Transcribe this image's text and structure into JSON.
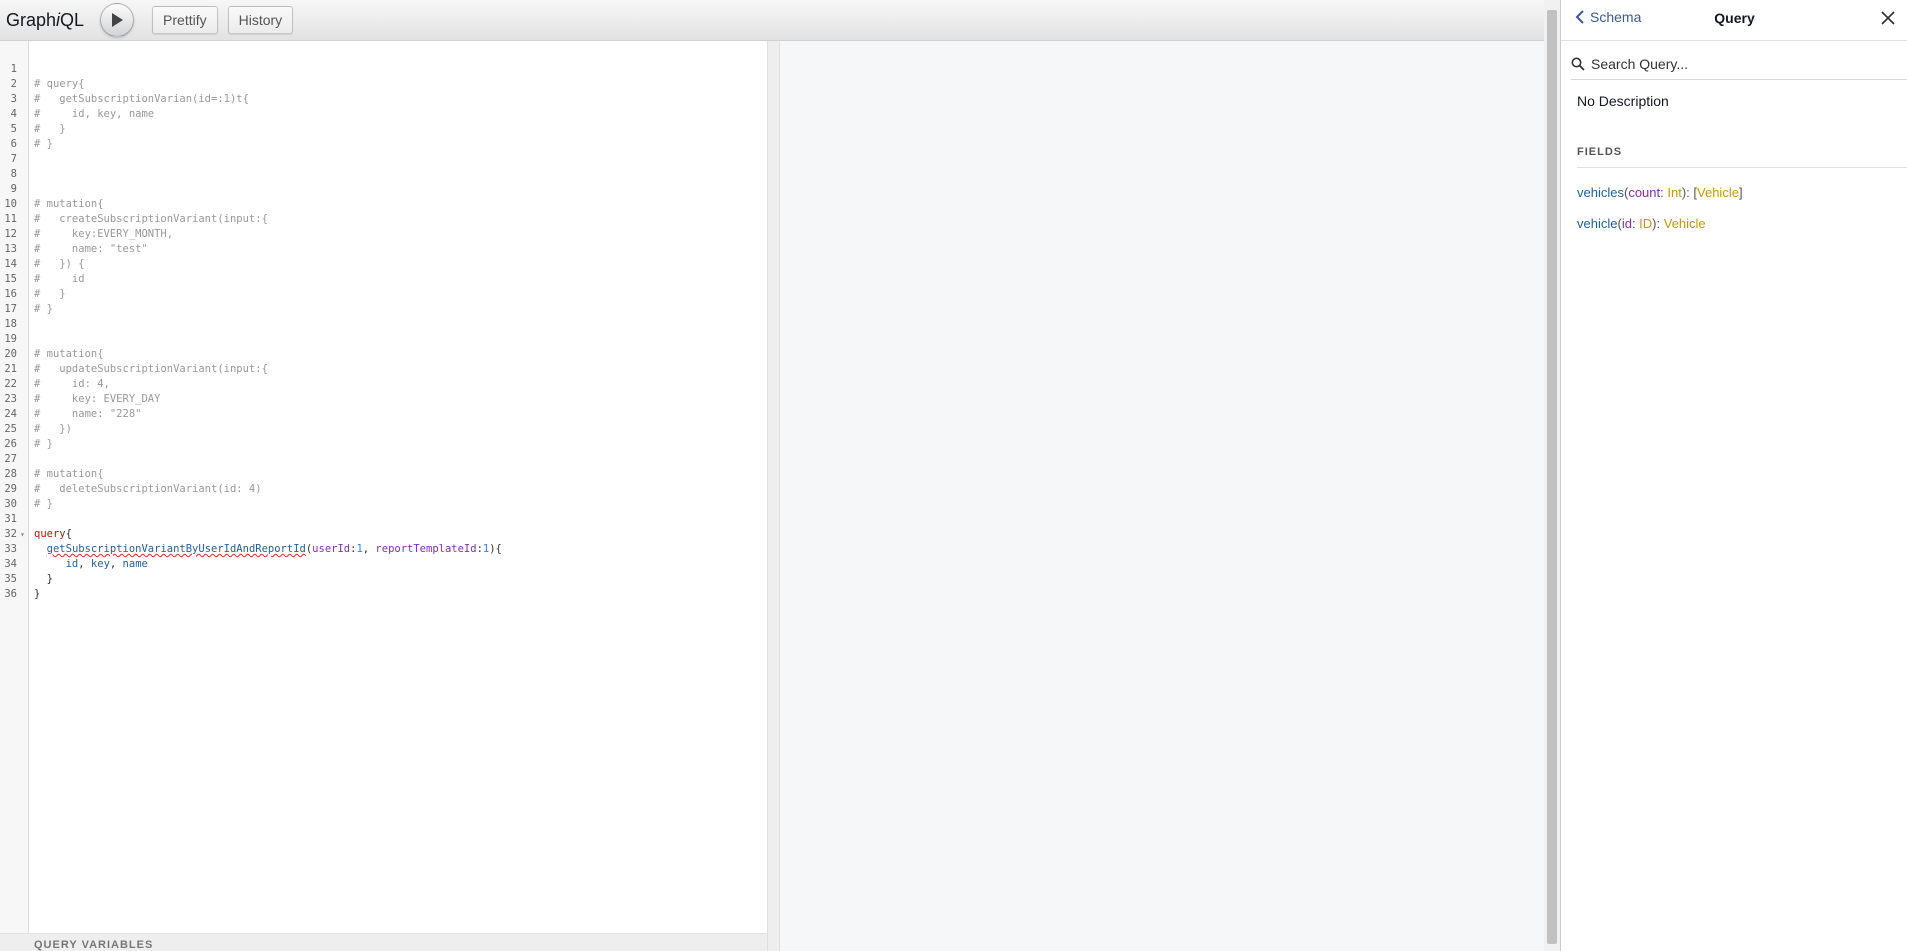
{
  "app": {
    "title_pre": "Graph",
    "title_i": "i",
    "title_post": "QL"
  },
  "toolbar": {
    "prettify_label": "Prettify",
    "history_label": "History"
  },
  "editor": {
    "lines": [
      {
        "n": "1",
        "parts": []
      },
      {
        "n": "2",
        "parts": [
          {
            "t": "# query{",
            "c": "c"
          }
        ]
      },
      {
        "n": "3",
        "parts": [
          {
            "t": "#   getSubscriptionVarian(id=:1)t{",
            "c": "c"
          }
        ]
      },
      {
        "n": "4",
        "parts": [
          {
            "t": "#     id, key, name",
            "c": "c"
          }
        ]
      },
      {
        "n": "5",
        "parts": [
          {
            "t": "#   }",
            "c": "c"
          }
        ]
      },
      {
        "n": "6",
        "parts": [
          {
            "t": "# }",
            "c": "c"
          }
        ]
      },
      {
        "n": "7",
        "parts": []
      },
      {
        "n": "8",
        "parts": []
      },
      {
        "n": "9",
        "parts": []
      },
      {
        "n": "10",
        "parts": [
          {
            "t": "# mutation{",
            "c": "c"
          }
        ]
      },
      {
        "n": "11",
        "parts": [
          {
            "t": "#   createSubscriptionVariant(input:{",
            "c": "c"
          }
        ]
      },
      {
        "n": "12",
        "parts": [
          {
            "t": "#     key:EVERY_MONTH,",
            "c": "c"
          }
        ]
      },
      {
        "n": "13",
        "parts": [
          {
            "t": "#     name: \"test\"",
            "c": "c"
          }
        ]
      },
      {
        "n": "14",
        "parts": [
          {
            "t": "#   }) {",
            "c": "c"
          }
        ]
      },
      {
        "n": "15",
        "parts": [
          {
            "t": "#     id",
            "c": "c"
          }
        ]
      },
      {
        "n": "16",
        "parts": [
          {
            "t": "#   }",
            "c": "c"
          }
        ]
      },
      {
        "n": "17",
        "parts": [
          {
            "t": "# }",
            "c": "c"
          }
        ]
      },
      {
        "n": "18",
        "parts": []
      },
      {
        "n": "19",
        "parts": []
      },
      {
        "n": "20",
        "parts": [
          {
            "t": "# mutation{",
            "c": "c"
          }
        ]
      },
      {
        "n": "21",
        "parts": [
          {
            "t": "#   updateSubscriptionVariant(input:{",
            "c": "c"
          }
        ]
      },
      {
        "n": "22",
        "parts": [
          {
            "t": "#     id: 4,",
            "c": "c"
          }
        ]
      },
      {
        "n": "23",
        "parts": [
          {
            "t": "#     key: EVERY_DAY",
            "c": "c"
          }
        ]
      },
      {
        "n": "24",
        "parts": [
          {
            "t": "#     name: \"228\"",
            "c": "c"
          }
        ]
      },
      {
        "n": "25",
        "parts": [
          {
            "t": "#   })",
            "c": "c"
          }
        ]
      },
      {
        "n": "26",
        "parts": [
          {
            "t": "# }",
            "c": "c"
          }
        ]
      },
      {
        "n": "27",
        "parts": []
      },
      {
        "n": "28",
        "parts": [
          {
            "t": "# mutation{",
            "c": "c"
          }
        ]
      },
      {
        "n": "29",
        "parts": [
          {
            "t": "#   deleteSubscriptionVariant(id: 4)",
            "c": "c"
          }
        ]
      },
      {
        "n": "30",
        "parts": [
          {
            "t": "# }",
            "c": "c"
          }
        ]
      },
      {
        "n": "31",
        "parts": []
      },
      {
        "n": "32",
        "fold": true,
        "parts": [
          {
            "t": "query",
            "c": "kw"
          },
          {
            "t": "{",
            "c": ""
          }
        ]
      },
      {
        "n": "33",
        "parts": [
          {
            "t": "  ",
            "c": ""
          },
          {
            "t": "getSubscriptionVariantByUserIdAndReportId",
            "c": "def squiggle"
          },
          {
            "t": "(",
            "c": ""
          },
          {
            "t": "userId",
            "c": "atr"
          },
          {
            "t": ":",
            "c": ""
          },
          {
            "t": "1",
            "c": "num"
          },
          {
            "t": ", ",
            "c": ""
          },
          {
            "t": "reportTemplateId",
            "c": "atr"
          },
          {
            "t": ":",
            "c": ""
          },
          {
            "t": "1",
            "c": "num"
          },
          {
            "t": "){",
            "c": ""
          }
        ]
      },
      {
        "n": "34",
        "parts": [
          {
            "t": "     ",
            "c": ""
          },
          {
            "t": "id",
            "c": "def"
          },
          {
            "t": ", ",
            "c": ""
          },
          {
            "t": "key",
            "c": "def"
          },
          {
            "t": ", ",
            "c": ""
          },
          {
            "t": "name",
            "c": "def"
          }
        ]
      },
      {
        "n": "35",
        "parts": [
          {
            "t": "  }",
            "c": ""
          }
        ]
      },
      {
        "n": "36",
        "parts": [
          {
            "t": "}",
            "c": ""
          }
        ]
      }
    ]
  },
  "variables": {
    "header": "QUERY VARIABLES"
  },
  "docs": {
    "back_label": "Schema",
    "title": "Query",
    "search_placeholder": "Search Query...",
    "description": "No Description",
    "fields_header": "FIELDS",
    "fields": [
      {
        "name": "vehicles",
        "arg": "count",
        "arg_type": "Int",
        "type_open": "[",
        "type": "Vehicle",
        "type_close": "]"
      },
      {
        "name": "vehicle",
        "arg": "id",
        "arg_type": "ID",
        "type_open": "",
        "type": "Vehicle",
        "type_close": ""
      }
    ]
  }
}
